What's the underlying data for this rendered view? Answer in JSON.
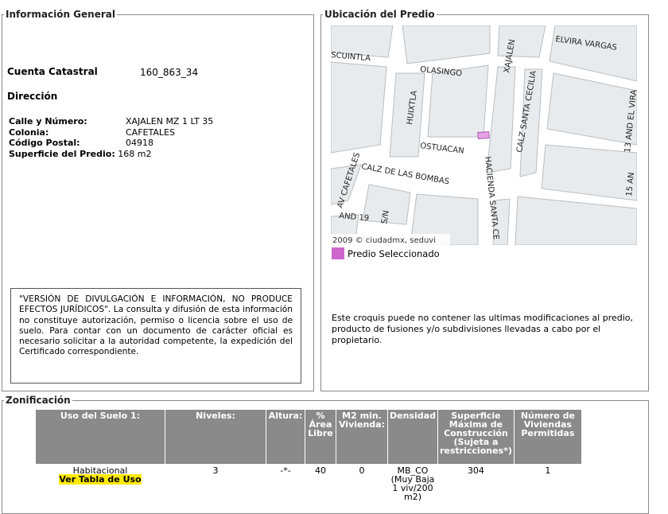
{
  "info_general": {
    "legend": "Información General",
    "cuenta_label": "Cuenta Catastral",
    "cuenta_value": "160_863_34",
    "direccion_label": "Dirección",
    "calle_label": "Calle y Número:",
    "calle_value": "XAJALEN MZ 1 LT 35",
    "colonia_label": "Colonia:",
    "colonia_value": "CAFETALES",
    "cp_label": "Código Postal:",
    "cp_value": "04918",
    "superficie_label": "Superficie del Predio:",
    "superficie_value": "168 m2",
    "disclaimer": "\"VERSIÓN DE DIVULGACIÓN E INFORMACIÓN, NO PRODUCE EFECTOS JURÍDICOS\". La consulta y difusión de esta información no constituye autorización, permiso o licencia sobre el uso de suelo. Para contar con un documento de carácter oficial es necesario solicitar a la autoridad competente, la expedición del Certificado correspondiente."
  },
  "ubicacion": {
    "legend": "Ubicación del Predio",
    "map_credit": "2009 © ciudadmx, seduvi",
    "streets": [
      "ELVIRA VARGAS",
      "SCUINTLA",
      "OLASINGO",
      "XAJALEN",
      "HUIXTLA",
      "CALZ SANTA CECILIA",
      "OSTUACAN",
      "CALZ DE LAS BOMBAS",
      "AV CAFETALES",
      "HACIENDA SANTA CE",
      "AND 19",
      "S/N",
      "13 AND EL VIRA",
      "15 AN"
    ],
    "legend_label": "Predio Seleccionado",
    "selected_color": "#cc66cc",
    "note": "Este croquis puede no contener las ultimas modificaciones al predio, producto de fusiones y/o subdivisiones llevadas a cabo por el propietario."
  },
  "zonificacion": {
    "legend": "Zonificación",
    "headers": [
      "Uso del Suelo 1:",
      "Niveles:",
      "Altura:",
      "% Área Libre",
      "M2 min. Vivienda:",
      "Densidad",
      "Superficie Máxima de Construcción (Sujeta a restricciones*)",
      "Número de Viviendas Permitidas"
    ],
    "row": {
      "uso": "Habitacional",
      "uso_link": "Ver Tabla de Uso",
      "niveles": "3",
      "altura": "-*-",
      "area_libre": "40",
      "m2_min": "0",
      "densidad": "MB_CO (Muy Baja 1 viv/200 m2)",
      "superficie_max": "304",
      "num_viviendas": "1"
    }
  }
}
